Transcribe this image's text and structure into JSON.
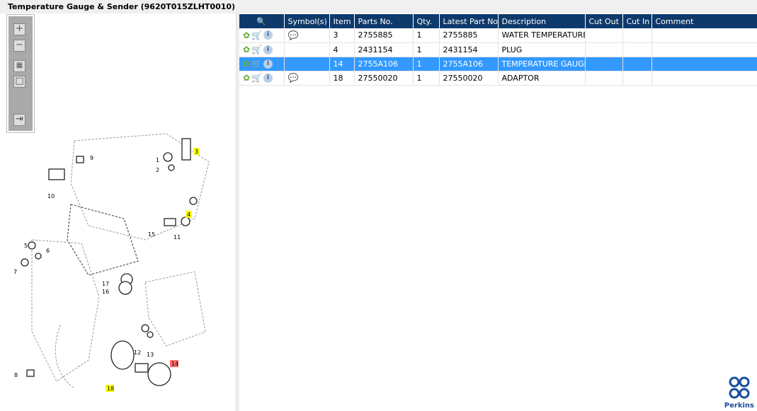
{
  "title": "Temperature Gauge & Sender (9620T015ZLHT0010)",
  "toolbar": {
    "zoom_in": "+",
    "zoom_out": "−",
    "fit": "▦",
    "actual": "□",
    "export": "⇥"
  },
  "grid": {
    "columns": [
      "",
      "Symbol(s)",
      "Item",
      "Parts No.",
      "Qty.",
      "Latest Part No.",
      "Description",
      "Cut Out",
      "Cut In",
      "Comment"
    ],
    "rows": [
      {
        "symbol": "💬",
        "item": "3",
        "part": "2755885",
        "qty": "1",
        "latest": "2755885",
        "desc": "WATER TEMPERATURE SENDER",
        "cut_out": "",
        "cut_in": "",
        "comment": ""
      },
      {
        "symbol": "",
        "item": "4",
        "part": "2431154",
        "qty": "1",
        "latest": "2431154",
        "desc": "PLUG",
        "cut_out": "",
        "cut_in": "",
        "comment": ""
      },
      {
        "symbol": "",
        "item": "14",
        "part": "2755A106",
        "qty": "1",
        "latest": "2755A106",
        "desc": "TEMPERATURE GAUGE",
        "cut_out": "",
        "cut_in": "",
        "comment": ""
      },
      {
        "symbol": "💬",
        "item": "18",
        "part": "27550020",
        "qty": "1",
        "latest": "27550020",
        "desc": "ADAPTOR",
        "cut_out": "",
        "cut_in": "",
        "comment": ""
      }
    ]
  },
  "callouts": [
    "3",
    "9",
    "1",
    "2",
    "10",
    "4",
    "15",
    "11",
    "5",
    "6",
    "7",
    "17",
    "16",
    "12",
    "13",
    "14",
    "18",
    "8"
  ],
  "logo": "Perkins",
  "colors": {
    "header": "#0e3a6b",
    "selected": "#3399ff",
    "highlight_yellow": "#ffff00",
    "highlight_red": "#ff6b6b"
  }
}
